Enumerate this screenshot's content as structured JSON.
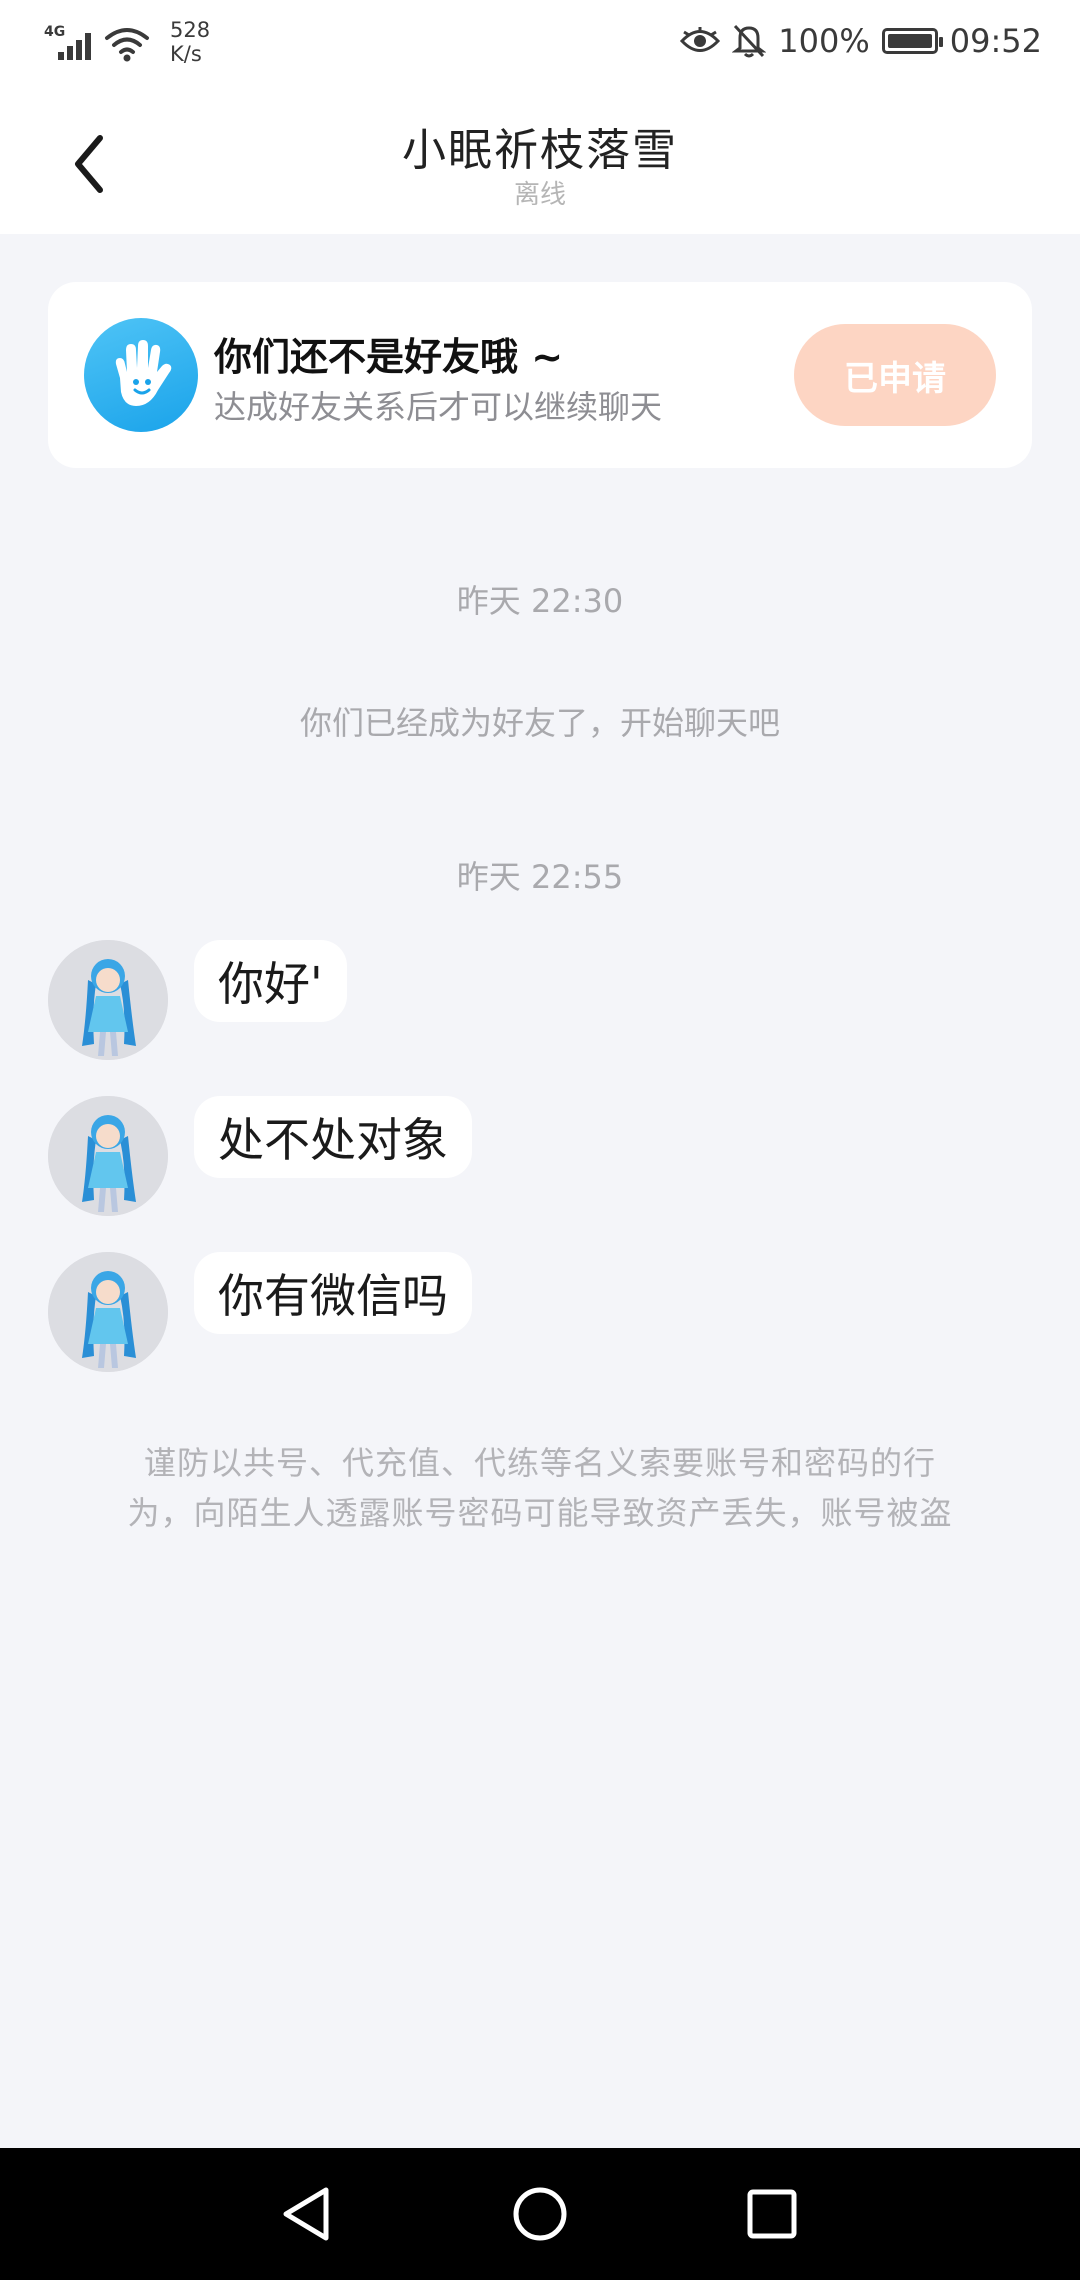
{
  "status_bar": {
    "network_type": "4G",
    "speed_value": "528",
    "speed_unit": "K/s",
    "battery": "100%",
    "time": "09:52",
    "icons": [
      "signal-icon",
      "wifi-icon",
      "eye-icon",
      "bell-off-icon",
      "battery-icon"
    ]
  },
  "header": {
    "title": "小眠祈枝落雪",
    "status": "离线",
    "back_icon": "chevron-left-icon"
  },
  "friend_notice": {
    "icon": "hand-wave-icon",
    "title": "你们还不是好友哦 ~",
    "description": "达成好友关系后才可以继续聊天",
    "button_label": "已申请",
    "accent_color": "#1aa3ea",
    "button_color": "#fdd5c3"
  },
  "timeline": [
    {
      "time": "昨天 22:30",
      "system_message": "你们已经成为好友了，开始聊天吧"
    },
    {
      "time": "昨天 22:55"
    }
  ],
  "messages": [
    {
      "text": "你好'",
      "sender_avatar": "anime-girl-avatar"
    },
    {
      "text": "处不处对象",
      "sender_avatar": "anime-girl-avatar"
    },
    {
      "text": "你有微信吗",
      "sender_avatar": "anime-girl-avatar"
    }
  ],
  "warning": {
    "line1": "谨防以共号、代充值、代练等名义索要账号和密码的行",
    "line2": "为，向陌生人透露账号密码可能导致资产丢失，账号被盗"
  },
  "nav_bar": {
    "icons": [
      "back-triangle-icon",
      "home-circle-icon",
      "recents-square-icon"
    ]
  }
}
